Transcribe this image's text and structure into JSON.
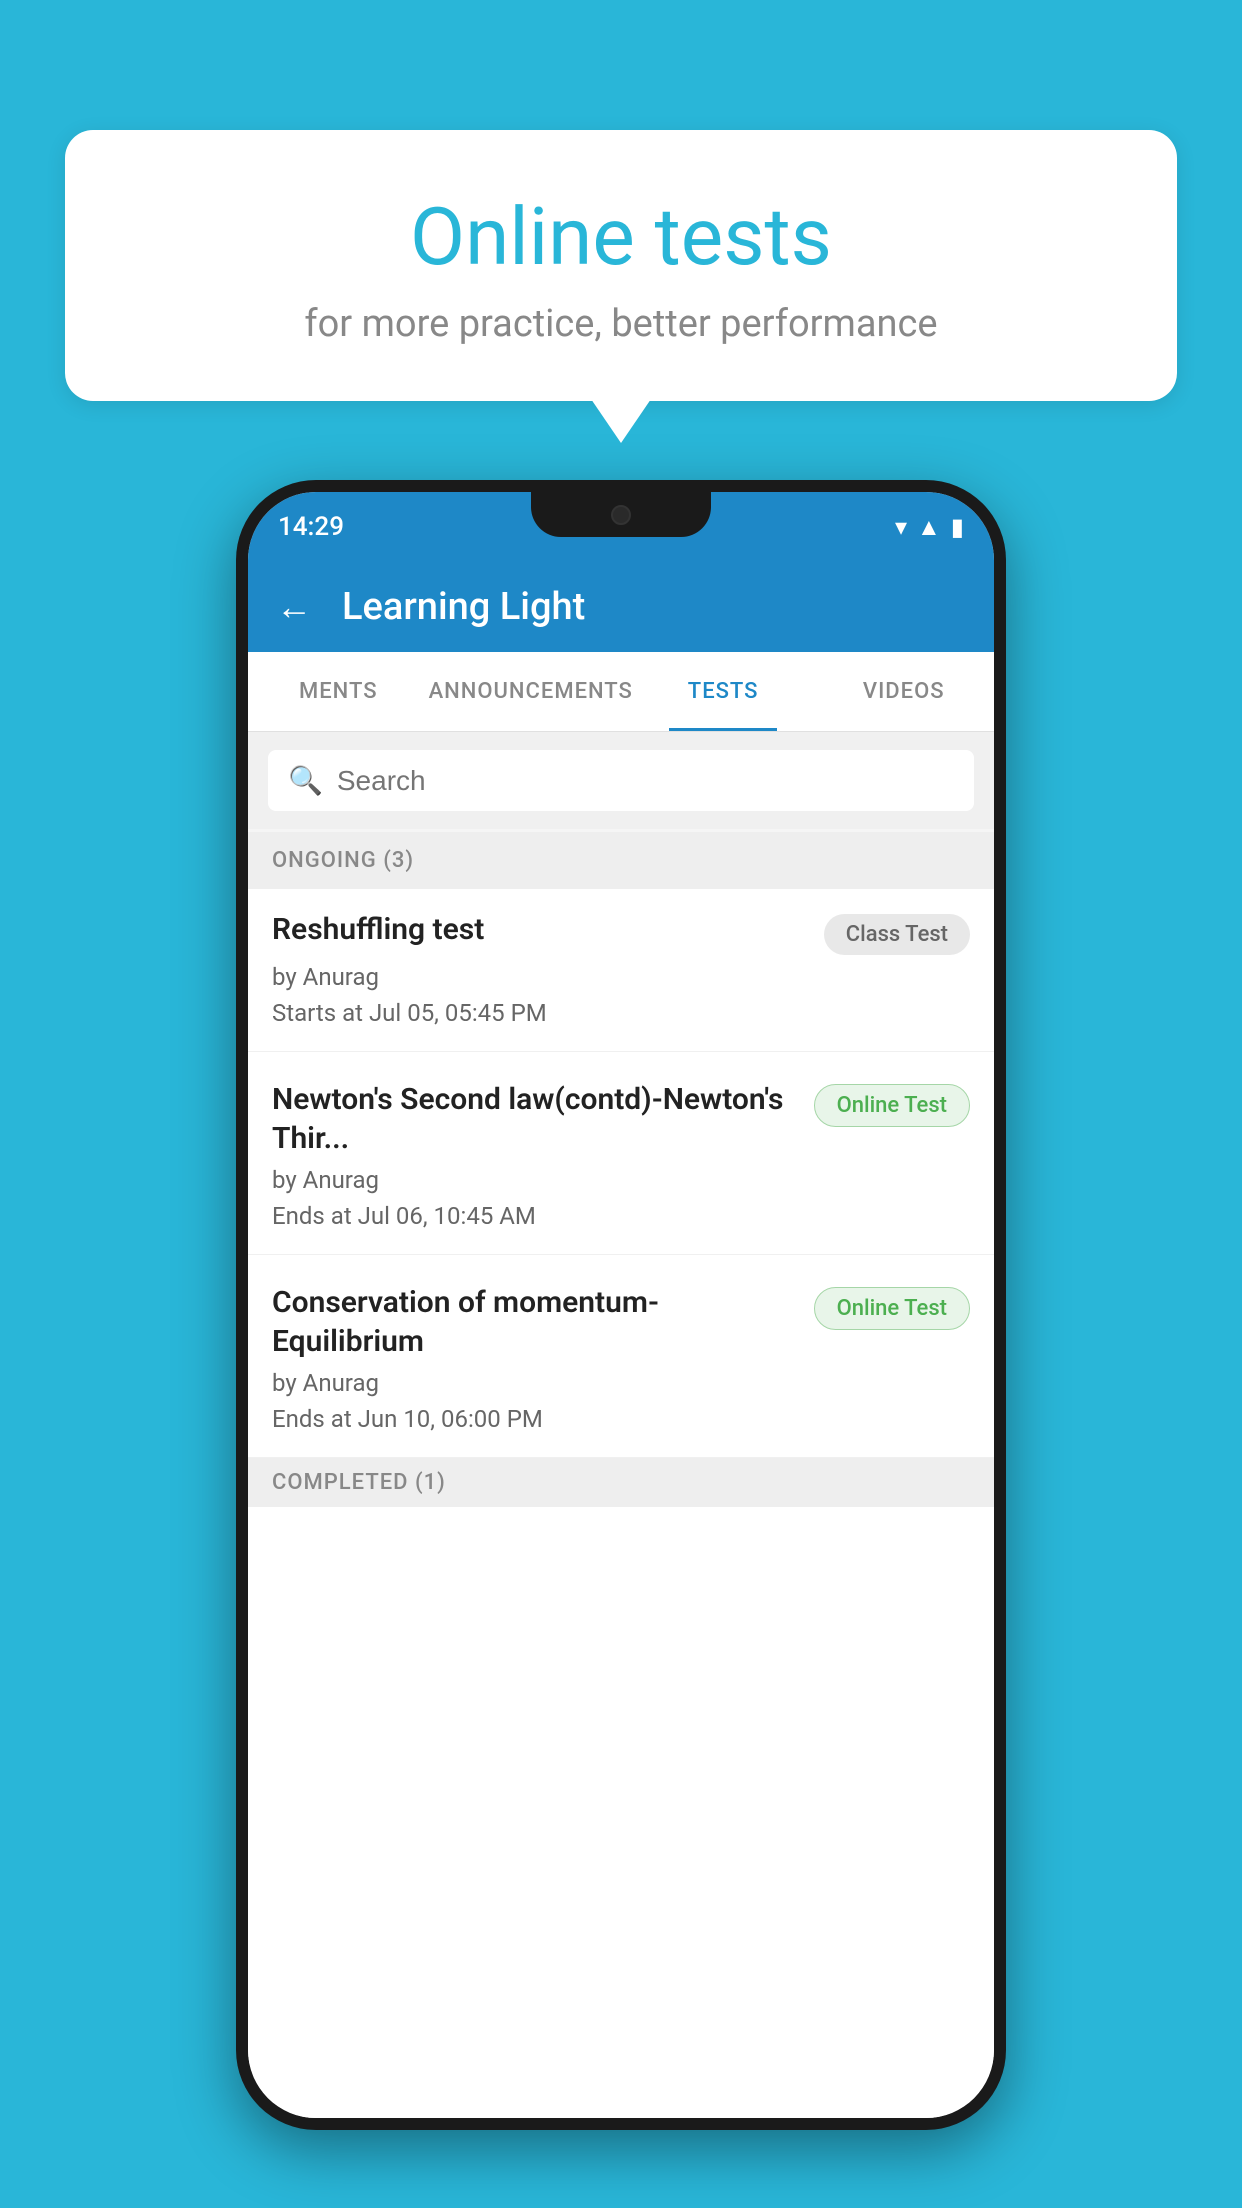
{
  "background_color": "#29b6d8",
  "speech_bubble": {
    "title": "Online tests",
    "subtitle": "for more practice, better performance"
  },
  "status_bar": {
    "time": "14:29",
    "icons": [
      "wifi",
      "signal",
      "battery"
    ]
  },
  "app_header": {
    "title": "Learning Light",
    "back_label": "←"
  },
  "tabs": [
    {
      "label": "MENTS",
      "active": false
    },
    {
      "label": "ANNOUNCEMENTS",
      "active": false
    },
    {
      "label": "TESTS",
      "active": true
    },
    {
      "label": "VIDEOS",
      "active": false
    }
  ],
  "search": {
    "placeholder": "Search"
  },
  "section_ongoing": {
    "label": "ONGOING (3)"
  },
  "tests": [
    {
      "name": "Reshuffling test",
      "badge": "Class Test",
      "badge_type": "class",
      "by": "by Anurag",
      "time_label": "Starts at",
      "time": "Jul 05, 05:45 PM"
    },
    {
      "name": "Newton's Second law(contd)-Newton's Thir...",
      "badge": "Online Test",
      "badge_type": "online",
      "by": "by Anurag",
      "time_label": "Ends at",
      "time": "Jul 06, 10:45 AM"
    },
    {
      "name": "Conservation of momentum-Equilibrium",
      "badge": "Online Test",
      "badge_type": "online",
      "by": "by Anurag",
      "time_label": "Ends at",
      "time": "Jun 10, 06:00 PM"
    }
  ],
  "section_completed": {
    "label": "COMPLETED (1)"
  }
}
